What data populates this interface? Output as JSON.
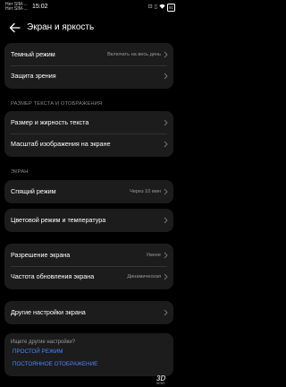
{
  "status_bar": {
    "carrier_line1": "Нет SIM-...",
    "carrier_line2": "Нет SIM-...",
    "time": "15:02",
    "battery": "91"
  },
  "header": {
    "title": "Экран и яркость"
  },
  "groups": {
    "top": [
      {
        "label": "Темный режим",
        "value": "Включать на весь день"
      },
      {
        "label": "Защита зрения",
        "value": ""
      }
    ],
    "text_section_title": "РАЗМЕР ТЕКСТА И ОТОБРАЖЕНИЯ",
    "text": [
      {
        "label": "Размер и жирность текста",
        "value": ""
      },
      {
        "label": "Масштаб изображения на экране",
        "value": ""
      }
    ],
    "screen_section_title": "ЭКРАН",
    "sleep": {
      "label": "Спящий режим",
      "value": "Через 10 мин"
    },
    "color": {
      "label": "Цветовой режим и температура",
      "value": ""
    },
    "display": [
      {
        "label": "Разрешение экрана",
        "value": "Умное"
      },
      {
        "label": "Частота обновления экрана",
        "value": "Динамическая"
      }
    ],
    "other": {
      "label": "Другие настройки экрана",
      "value": ""
    }
  },
  "suggestions": {
    "title": "Ищете другие настройки?",
    "links": [
      "ПРОСТОЙ РЕЖИМ",
      "ПОСТОЯННОЕ ОТОБРАЖЕНИЕ"
    ]
  },
  "colors": {
    "accent": "#4f86f7",
    "card": "#1c1c1c",
    "background": "#000000"
  }
}
